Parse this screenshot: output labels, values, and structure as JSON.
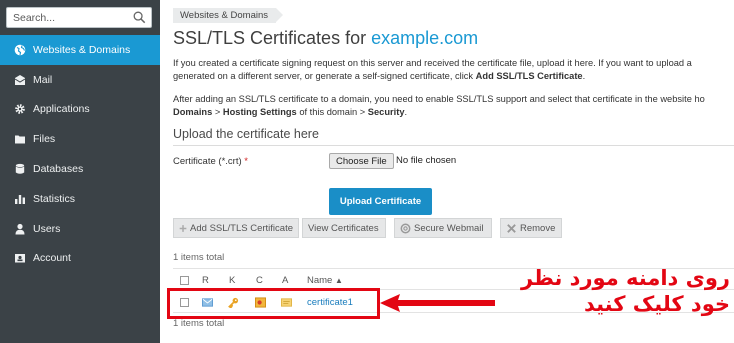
{
  "sidebar": {
    "search_placeholder": "Search...",
    "items": [
      {
        "label": "Websites & Domains",
        "icon": "globe-icon"
      },
      {
        "label": "Mail",
        "icon": "envelope-icon"
      },
      {
        "label": "Applications",
        "icon": "gear-icon"
      },
      {
        "label": "Files",
        "icon": "folder-icon"
      },
      {
        "label": "Databases",
        "icon": "database-icon"
      },
      {
        "label": "Statistics",
        "icon": "bar-chart-icon"
      },
      {
        "label": "Users",
        "icon": "user-icon"
      },
      {
        "label": "Account",
        "icon": "id-card-icon"
      }
    ]
  },
  "main": {
    "breadcrumb": "Websites & Domains",
    "title_prefix": "SSL/TLS Certificates for ",
    "title_domain": "example.com",
    "para1_line1": "If you created a certificate signing request on this server and received the certificate file, upload it here. If you want to upload a",
    "para1_line2_text": "generated on a different server, or generate a self-signed certificate, click ",
    "para1_line2_bold": "Add SSL/TLS Certificate",
    "para1_line2_end": ".",
    "para2_line1": "After adding an SSL/TLS certificate to a domain, you need to enable SSL/TLS support and select that certificate in the website ho",
    "para2_b1": "Domains",
    "para2_sep1": " > ",
    "para2_b2": "Hosting Settings",
    "para2_mid": " of this domain > ",
    "para2_b3": "Security",
    "para2_end": ".",
    "upload_section_title": "Upload the certificate here",
    "field_label": "Certificate (*.crt)",
    "required_mark": "*",
    "choose_file_label": "Choose File",
    "no_file_text": "No file chosen",
    "upload_button": "Upload Certificate",
    "toolbar": {
      "add": "Add SSL/TLS Certificate",
      "view": "View Certificates",
      "webmail": "Secure Webmail",
      "remove": "Remove"
    },
    "items_total": "1 items total",
    "columns": [
      "R",
      "K",
      "C",
      "A",
      "Name"
    ],
    "row": {
      "name": "certificate1"
    }
  },
  "annotation": {
    "line1": "روی دامنه مورد نظر",
    "line2": "خود کلیک کنید",
    "color": "#e30613"
  }
}
